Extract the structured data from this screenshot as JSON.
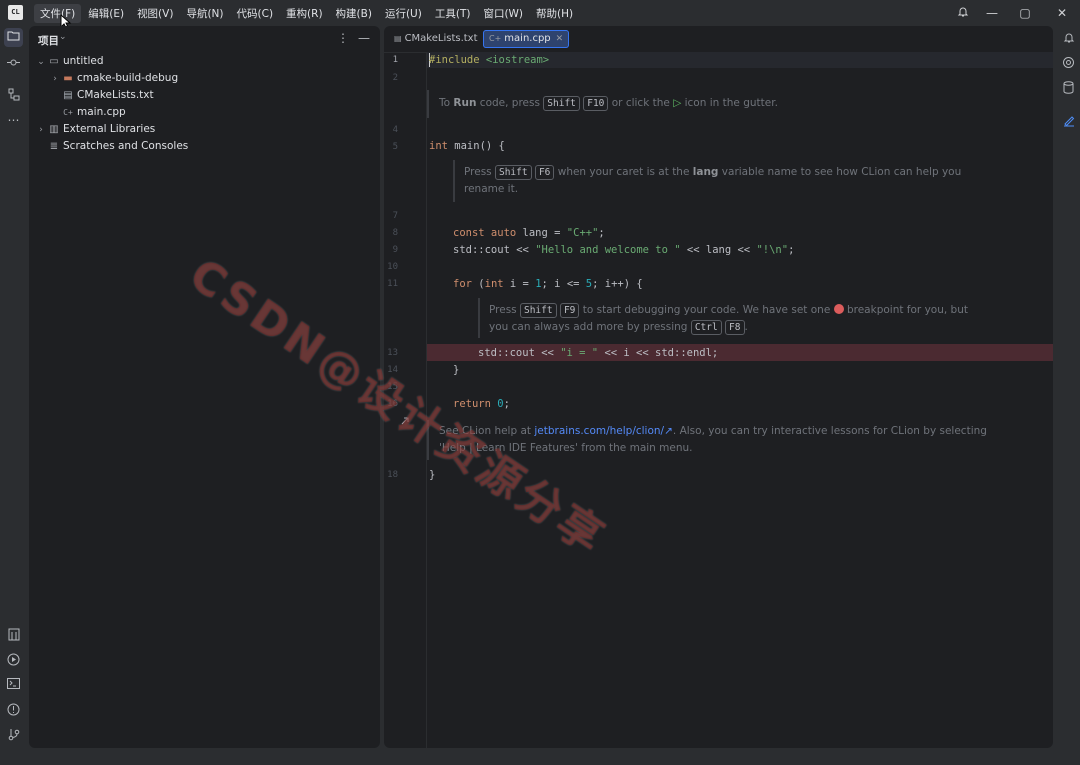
{
  "app": {
    "logo_text": "CL",
    "menu": [
      "文件(F)",
      "编辑(E)",
      "视图(V)",
      "导航(N)",
      "代码(C)",
      "重构(R)",
      "构建(B)",
      "运行(U)",
      "工具(T)",
      "窗口(W)",
      "帮助(H)"
    ]
  },
  "window_controls": {
    "notifications_icon": "bell-icon",
    "minimize": "—",
    "maximize": "▢",
    "close": "✕"
  },
  "project_panel": {
    "title": "项目",
    "tree": [
      {
        "label": "untitled",
        "type": "project-folder",
        "expanded": true,
        "indent": 0
      },
      {
        "label": "cmake-build-debug",
        "type": "excluded-folder",
        "expanded": false,
        "indent": 1
      },
      {
        "label": "CMakeLists.txt",
        "type": "cmake-file",
        "indent": 1
      },
      {
        "label": "main.cpp",
        "type": "cpp-file",
        "indent": 1
      },
      {
        "label": "External Libraries",
        "type": "library",
        "expanded": false,
        "indent": 0
      },
      {
        "label": "Scratches and Consoles",
        "type": "scratches",
        "indent": 0
      }
    ]
  },
  "editor": {
    "tabs": [
      {
        "label": "CMakeLists.txt",
        "active": false
      },
      {
        "label": "main.cpp",
        "active": true
      }
    ],
    "line_numbers": [
      "1",
      "2",
      "4",
      "5",
      "7",
      "8",
      "9",
      "10",
      "11",
      "13",
      "14",
      "15",
      "16",
      "18"
    ],
    "code": {
      "include_kw": "#include",
      "include_hdr": " <iostream>",
      "main_kw": "int",
      "main_rest": " main() {",
      "const_kw": "const auto",
      "lang_decl": " lang = ",
      "lang_val": "\"C++\"",
      "cout1_ns": "std::",
      "cout1_a": "cout << ",
      "cout1_str": "\"Hello and welcome to \"",
      "cout1_b": " << lang << ",
      "cout1_str2": "\"!\\n\"",
      "for_kw": "for",
      "for_a": " (",
      "for_int": "int",
      "for_b": " i = ",
      "for_one": "1",
      "for_c": "; i <= ",
      "for_five": "5",
      "for_d": "; i++) {",
      "cout2_ns": "std::",
      "cout2_a": "cout << ",
      "cout2_str": "\"i = \"",
      "cout2_b": " << i << ",
      "cout2_ns2": "std::",
      "cout2_c": "endl;",
      "close_inner": "}",
      "return_kw": "return",
      "return_val": "0",
      "close_outer": "}"
    },
    "hints": {
      "run": {
        "pre": "To ",
        "bold": "Run",
        "mid": " code, press ",
        "k1": "Shift",
        "k2": "F10",
        "post": " or click the ",
        "post2": " icon in the gutter."
      },
      "rename": {
        "pre": "Press ",
        "k1": "Shift",
        "k2": "F6",
        "mid": " when your caret is at the ",
        "bold": "lang",
        "post": " variable name to see how CLion can help you",
        "line2": "rename it."
      },
      "debug": {
        "pre": "Press ",
        "k1": "Shift",
        "k2": "F9",
        "mid": " to start debugging your code. We have set one ",
        "post": " breakpoint for you, but",
        "line2pre": "you can always add more by pressing ",
        "k3": "Ctrl",
        "k4": "F8",
        "line2post": "."
      },
      "help": {
        "pre": "See CLion help at ",
        "link": "jetbrains.com/help/clion/",
        "arrow": "↗",
        "post": ". Also, you can try interactive lessons for CLion by selecting",
        "line2": "'Help | Learn IDE Features' from the main menu."
      }
    }
  },
  "colors": {
    "background": "#2b2d30",
    "editor_bg": "#1e1f22",
    "keyword": "#cf8e6d",
    "string": "#6aab73",
    "number": "#2aacb8",
    "breakpoint_line": "#4b2a31",
    "breakpoint_dot": "#db5c5c"
  },
  "watermark": {
    "text": "CSDN@设计资源分享"
  }
}
